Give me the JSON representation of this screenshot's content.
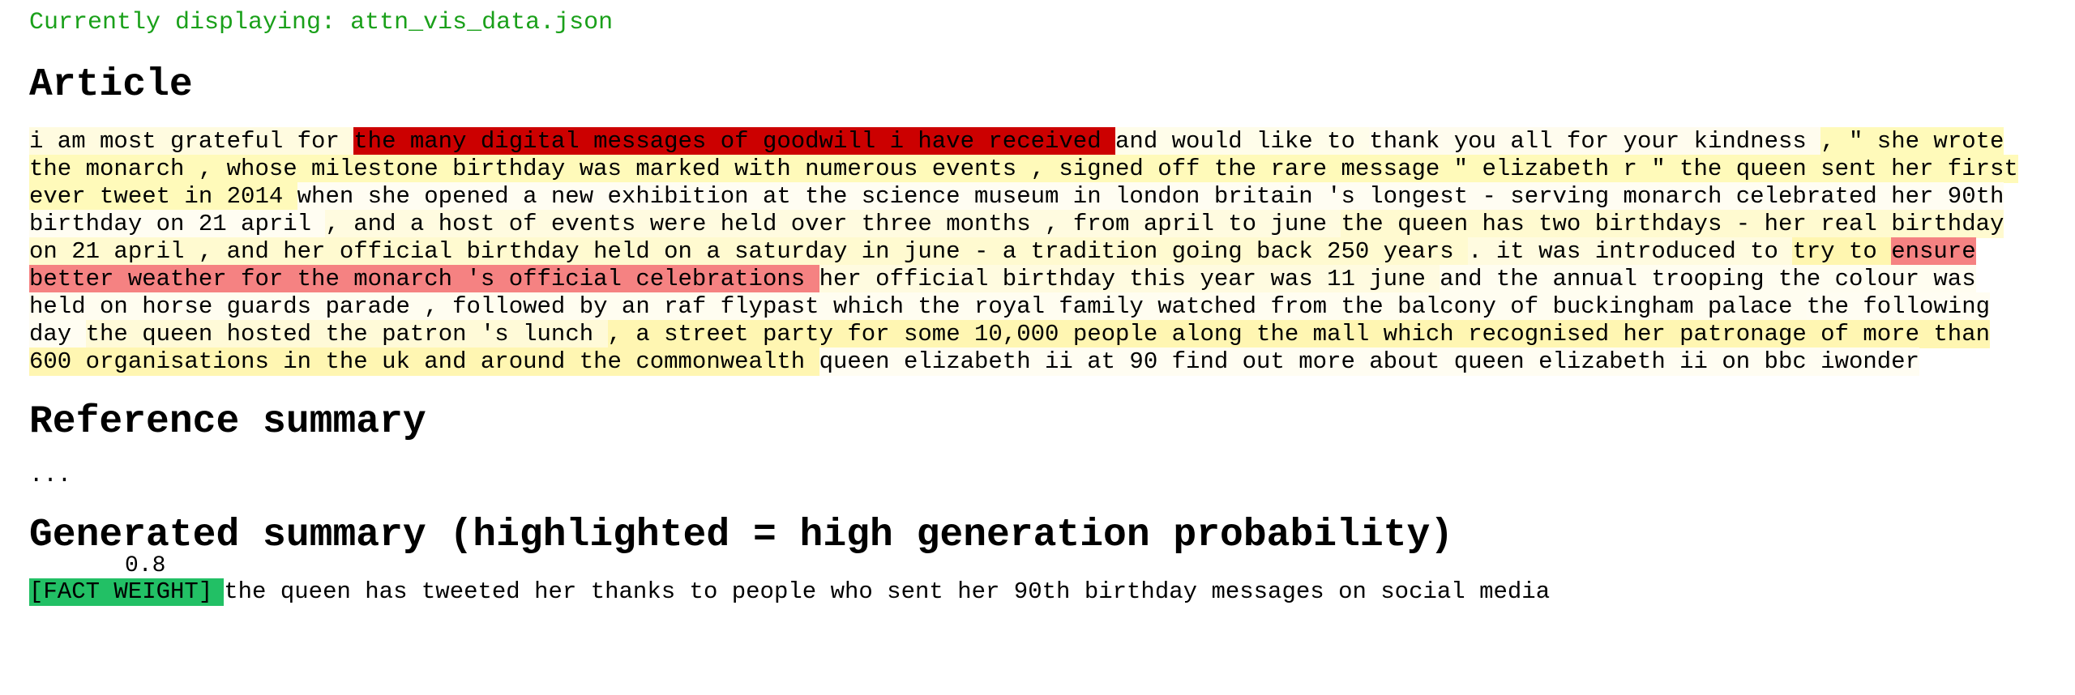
{
  "status": {
    "text": "Currently displaying: attn_vis_data.json",
    "color": "#1aa01a"
  },
  "article": {
    "heading": "Article",
    "tokens": [
      {
        "text": "i am most grateful for ",
        "bg": "#fffbe0"
      },
      {
        "text": "the many digital messages of goodwill i have received ",
        "bg": "#cc0000"
      },
      {
        "text": "and would like to ",
        "bg": "#fffdea"
      },
      {
        "text": "thank you all for your kindness ",
        "bg": "#fffcee"
      },
      {
        "text": ", \" she wrote the monarch , whose milestone birthday was marked with numerous events , signed off the rare message \" elizabeth r \" the queen sent her first ever tweet in 2014 ",
        "bg": "#fffaba"
      },
      {
        "text": "when she opened a new exhibition at the science museum in london britain 's longest - serving monarch celebrated her 90th birthday on 21 april ",
        "bg": "#fffdf2"
      },
      {
        "text": ", and a host of events were held over three months , from april to june ",
        "bg": "#fffbe0"
      },
      {
        "text": "the queen has two birthdays - her real birthday on 21 april , and her official birthday held on a saturday in june - a tradition going back 250 years ",
        "bg": "#fffad0"
      },
      {
        "text": ". it was introduced to ",
        "bg": "#fffbe0"
      },
      {
        "text": "try to ",
        "bg": "#fff6b0"
      },
      {
        "text": "ensure better weather for the monarch 's official celebrations ",
        "bg": "#f58282"
      },
      {
        "text": "her official birthday this year was 11 june ",
        "bg": "#fffbe0"
      },
      {
        "text": "and the annual trooping the colour was held on horse guards parade , followed by an raf flypast which the royal family watched from the balcony of buckingham palace ",
        "bg": "#fffdf0"
      },
      {
        "text": "the following day ",
        "bg": "#fffdf2"
      },
      {
        "text": "the queen hosted the patron 's lunch ",
        "bg": "#fffad8"
      },
      {
        "text": ", a street party for some 10,000 people along the mall which recognised her patronage of more than 600 organisations in the uk and around the commonwealth ",
        "bg": "#fff6b2"
      },
      {
        "text": "queen elizabeth ii at 90 find out more about queen elizabeth ii on bbc iwonder",
        "bg": "#fffdf2"
      }
    ]
  },
  "reference": {
    "heading": "Reference summary",
    "text": "..."
  },
  "generated": {
    "heading": "Generated summary (highlighted = high generation probability)",
    "fact_tag_label": "[FACT WEIGHT]",
    "fact_weight": "0.8",
    "fact_tag_color": "#22c065",
    "text": "the queen has tweeted her thanks to people who sent her 90th birthday messages on social media"
  }
}
